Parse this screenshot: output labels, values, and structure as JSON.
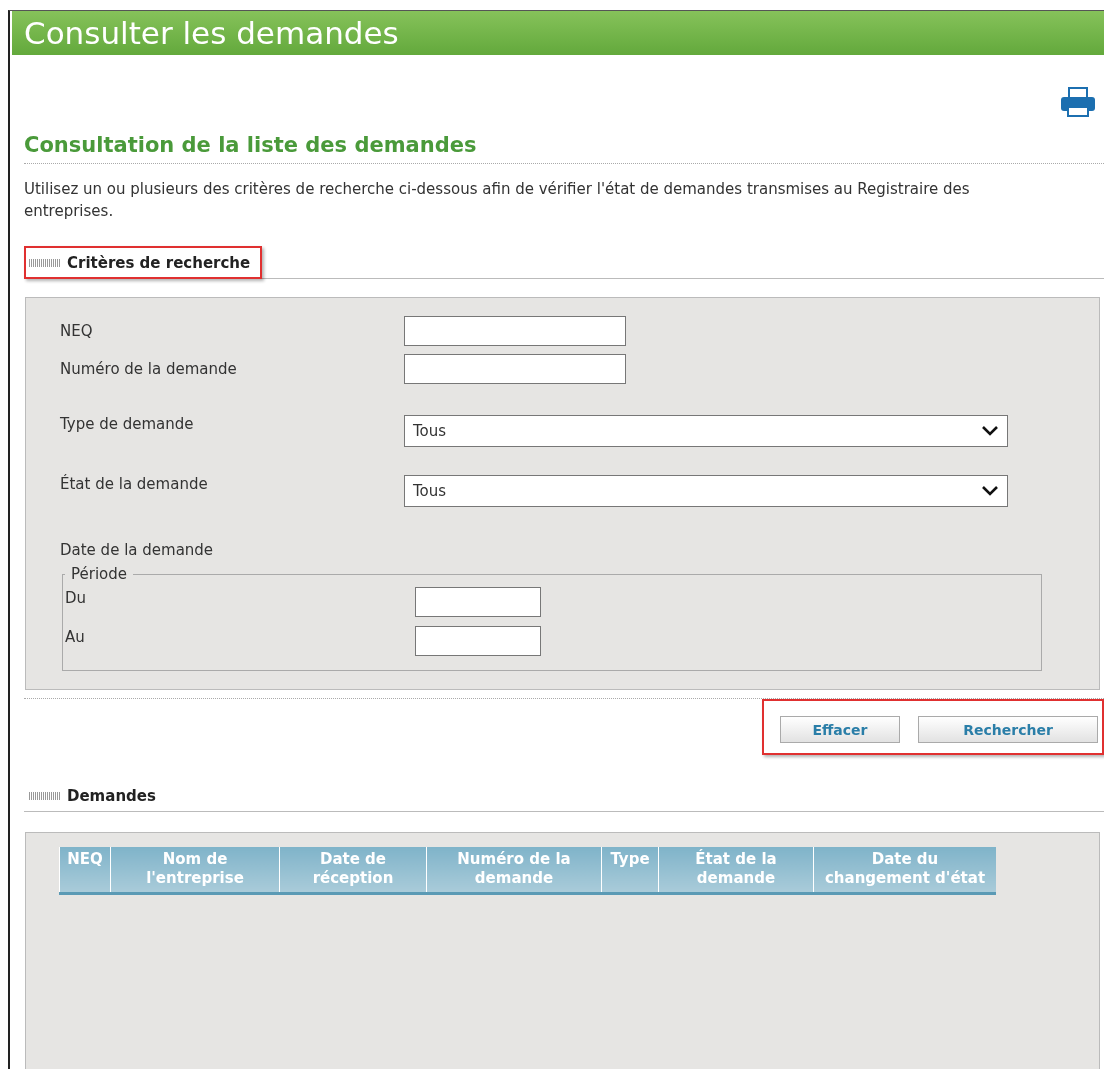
{
  "page_title": "Consulter les demandes",
  "heading": "Consultation de la liste des demandes",
  "intro": "Utilisez un ou plusieurs des critères de recherche ci-dessous afin de vérifier l'état de demandes transmises au Registraire des entreprises.",
  "criteria_section": {
    "title": "Critères de recherche",
    "highlighted": true
  },
  "fields": [
    {
      "kind": "text",
      "label": "NEQ"
    },
    {
      "kind": "text",
      "label": "Numéro de la demande"
    },
    {
      "kind": "select",
      "label": "Type de demande",
      "value": "Tous"
    },
    {
      "kind": "select",
      "label": "État de la demande",
      "value": "Tous"
    },
    {
      "kind": "label",
      "label": "Date de la demande"
    }
  ],
  "period": {
    "legend": "Période",
    "fields": [
      {
        "label": "Du"
      },
      {
        "label": "Au"
      }
    ]
  },
  "buttons": {
    "highlighted": true,
    "items": [
      "Effacer",
      "Rechercher"
    ]
  },
  "results_section": {
    "title": "Demandes"
  },
  "table": {
    "columns": [
      "NEQ",
      "Nom de l'entreprise",
      "Date de réception",
      "Numéro de la demande",
      "Type",
      "État de la demande",
      "Date du changement d'état"
    ]
  }
}
